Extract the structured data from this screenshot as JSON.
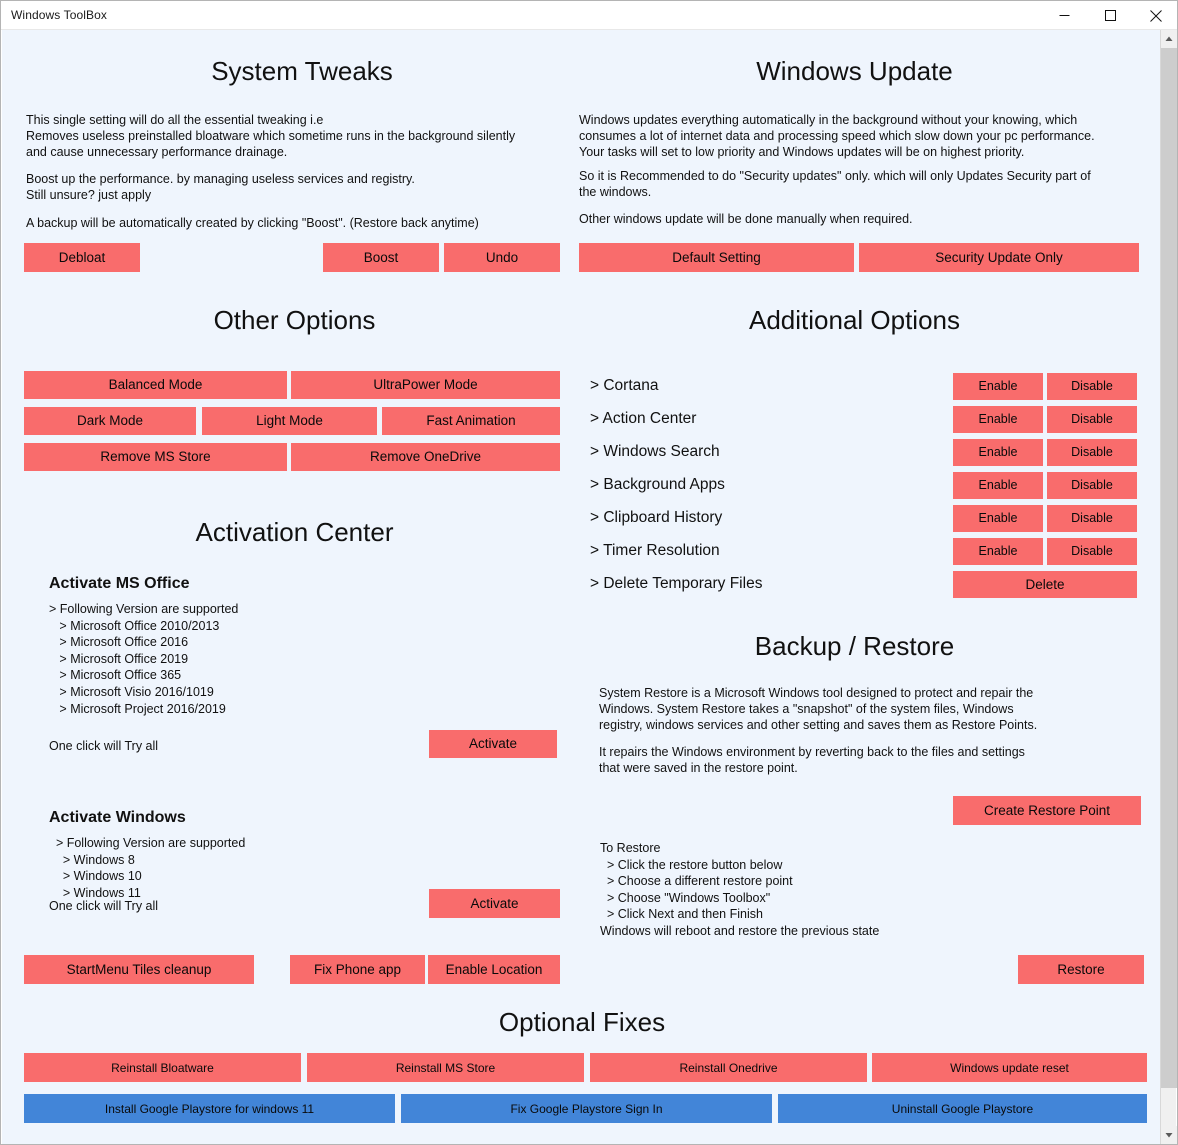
{
  "window": {
    "title": "Windows ToolBox",
    "controls": {
      "minimize": "minimize",
      "maximize": "maximize",
      "close": "close"
    }
  },
  "colors": {
    "accent_red": "#f96c6c",
    "accent_blue": "#4285d8",
    "background": "#eff5fd",
    "titlebar": "#ffffff"
  },
  "system_tweaks": {
    "title": "System Tweaks",
    "paragraph1": "This single setting will do all the essential tweaking i.e\nRemoves useless preinstalled bloatware which sometime runs in the background silently\nand cause unnecessary performance drainage.",
    "paragraph2": "Boost up the performance. by managing useless services and registry.\nStill unsure? just apply",
    "paragraph3": "A backup will be automatically created by clicking \"Boost\". (Restore back anytime)",
    "buttons": {
      "debloat": "Debloat",
      "boost": "Boost",
      "undo": "Undo"
    }
  },
  "windows_update": {
    "title": "Windows Update",
    "paragraph1": "Windows updates everything automatically in the background without your knowing, which\nconsumes a lot of internet data and processing speed which slow down your pc performance.\nYour tasks will set to low priority and Windows updates will be on highest priority.",
    "paragraph2": "So it is Recommended to do \"Security updates\" only. which will only Updates Security part of\nthe windows.",
    "paragraph3": "Other windows update will be done manually when required.",
    "buttons": {
      "default_setting": "Default Setting",
      "security_update_only": "Security Update Only"
    }
  },
  "other_options": {
    "title": "Other Options",
    "buttons": {
      "balanced_mode": "Balanced Mode",
      "ultrapower_mode": "UltraPower Mode",
      "dark_mode": "Dark Mode",
      "light_mode": "Light Mode",
      "fast_animation": "Fast Animation",
      "remove_ms_store": "Remove MS Store",
      "remove_onedrive": "Remove OneDrive"
    }
  },
  "additional_options": {
    "title": "Additional Options",
    "enable_label": "Enable",
    "disable_label": "Disable",
    "delete_label": "Delete",
    "rows": [
      {
        "label": "> Cortana"
      },
      {
        "label": "> Action Center"
      },
      {
        "label": "> Windows Search"
      },
      {
        "label": "> Background Apps"
      },
      {
        "label": "> Clipboard History"
      },
      {
        "label": "> Timer Resolution"
      },
      {
        "label": "> Delete Temporary Files"
      }
    ]
  },
  "activation_center": {
    "title": "Activation Center",
    "office": {
      "heading": "Activate MS Office",
      "list": "> Following Version are supported\n   > Microsoft Office 2010/2013\n   > Microsoft Office 2016\n   > Microsoft Office 2019\n   > Microsoft Office 365\n   > Microsoft Visio 2016/1019\n   > Microsoft Project 2016/2019",
      "note": "One click will Try all",
      "button": "Activate"
    },
    "windows": {
      "heading": "Activate Windows",
      "list": "  > Following Version are supported\n    > Windows 8\n    > Windows 10\n    > Windows 11",
      "note": "One click will Try all",
      "button": "Activate"
    },
    "extra_buttons": {
      "startmenu_tiles_cleanup": "StartMenu Tiles cleanup",
      "fix_phone_app": "Fix Phone app",
      "enable_location": "Enable Location"
    }
  },
  "backup_restore": {
    "title": "Backup / Restore",
    "paragraph1": "System Restore is a Microsoft Windows tool designed to protect and repair the\nWindows. System Restore takes a \"snapshot\" of the system files, Windows\nregistry, windows services and other setting and saves them as Restore Points.",
    "paragraph2": "It repairs the Windows environment by reverting back to the files and settings\nthat were saved in the restore point.",
    "create_button": "Create Restore Point",
    "to_restore": "To Restore\n  > Click the restore button below\n  > Choose a different restore point\n  > Choose \"Windows Toolbox\"\n  > Click Next and then Finish\nWindows will reboot and restore the previous state",
    "restore_button": "Restore"
  },
  "optional_fixes": {
    "title": "Optional Fixes",
    "red_buttons": [
      "Reinstall Bloatware",
      "Reinstall MS Store",
      "Reinstall Onedrive",
      "Windows update reset"
    ],
    "blue_buttons": [
      "Install Google Playstore for windows 11",
      "Fix Google Playstore Sign In",
      "Uninstall Google Playstore"
    ]
  }
}
